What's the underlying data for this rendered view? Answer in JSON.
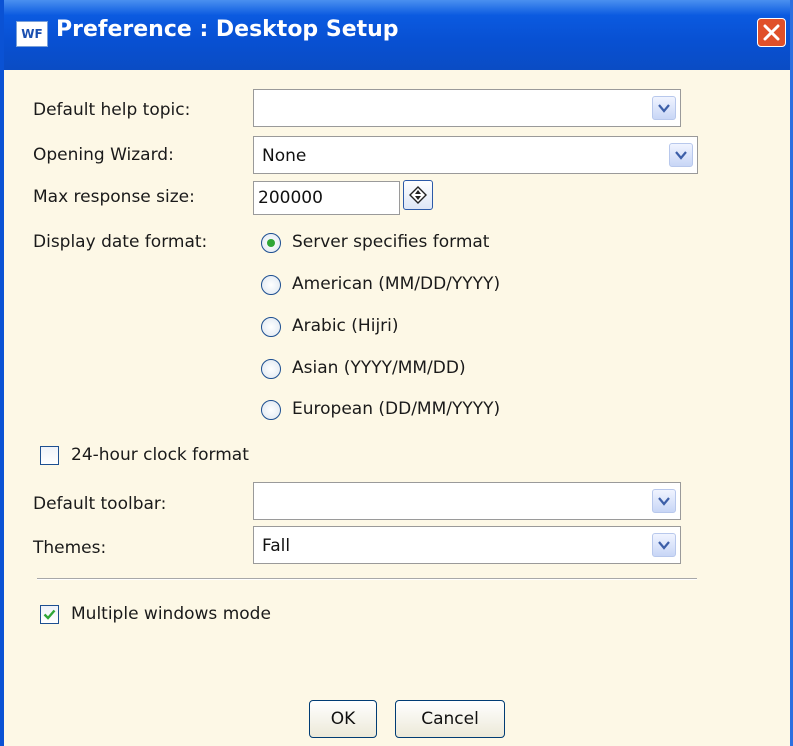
{
  "window": {
    "app_icon_text": "WF",
    "title": "Preference : Desktop Setup"
  },
  "form": {
    "default_help_topic": {
      "label": "Default help topic:",
      "value": ""
    },
    "opening_wizard": {
      "label": "Opening Wizard:",
      "value": "None"
    },
    "max_response_size": {
      "label": "Max response size:",
      "value": "200000"
    },
    "display_date_format": {
      "label": "Display date format:",
      "selected_index": 0,
      "options": [
        "Server specifies format",
        "American (MM/DD/YYYY)",
        "Arabic (Hijri)",
        "Asian (YYYY/MM/DD)",
        "European (DD/MM/YYYY)"
      ]
    },
    "clock_24_hour": {
      "label": "24-hour clock format",
      "checked": false
    },
    "default_toolbar": {
      "label": "Default toolbar:",
      "value": ""
    },
    "themes": {
      "label": "Themes:",
      "value": "Fall"
    },
    "multiple_windows": {
      "label": "Multiple windows mode",
      "checked": true
    }
  },
  "buttons": {
    "ok": "OK",
    "cancel": "Cancel"
  },
  "colors": {
    "title_bar": "#0850d2",
    "dialog_bg": "#fdf8e6",
    "close_button": "#e0502a",
    "radio_selected": "#2fa636",
    "checkmark": "#2fa636"
  },
  "icons": {
    "dropdown": "chevron-down-icon",
    "spinner": "diamond-spinner-icon",
    "close": "close-icon"
  }
}
